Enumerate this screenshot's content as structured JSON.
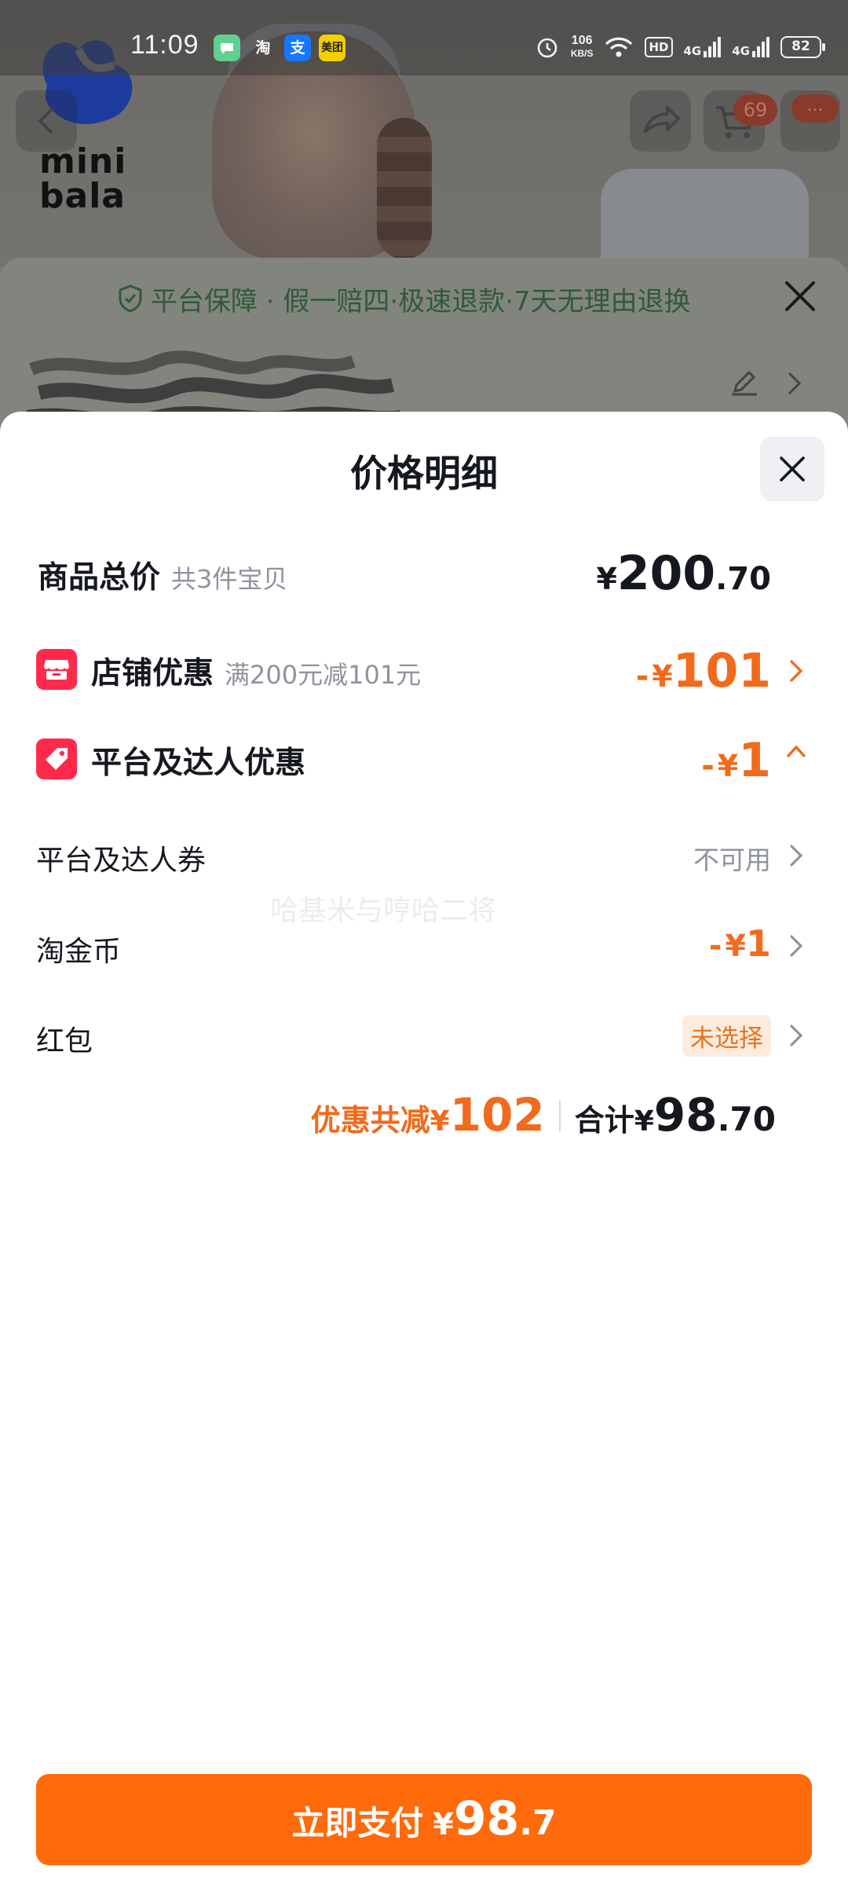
{
  "status_bar": {
    "time": "11:09",
    "apps": [
      {
        "name": "messages",
        "glyph": "",
        "color": "#5fd08f"
      },
      {
        "name": "taobao",
        "glyph": "淘",
        "color": "#5a5a5a"
      },
      {
        "name": "alipay",
        "glyph": "支",
        "color": "#1677ff"
      },
      {
        "name": "meituan",
        "glyph": "美团",
        "color": "#f5d000"
      }
    ],
    "net_speed_value": "106",
    "net_speed_unit": "KB/S",
    "hd_label": "HD",
    "signal1_label": "4G",
    "signal2_label": "4G",
    "battery": "82"
  },
  "background": {
    "brand_line1": "mini",
    "brand_line2": "bala",
    "cart_badge": "69",
    "more_badge": "...",
    "guarantee_text": "平台保障 · 假一赔四·极速退款·7天无理由退换"
  },
  "sheet": {
    "title": "价格明细",
    "total": {
      "label": "商品总价",
      "sub": "共3件宝贝",
      "currency": "¥",
      "int": "200",
      "dec": ".70"
    },
    "store_discount": {
      "label": "店铺优惠",
      "sub": "满200元减101元",
      "minus": "-",
      "currency": "¥",
      "value": "101"
    },
    "platform_discount": {
      "label": "平台及达人优惠",
      "minus": "-",
      "currency": "¥",
      "value": "1"
    },
    "platform_coupon": {
      "label": "平台及达人券",
      "value": "不可用"
    },
    "taojinbi": {
      "label": "淘金币",
      "minus": "-",
      "currency": "¥",
      "value": "1"
    },
    "red_packet": {
      "label": "红包",
      "value": "未选择"
    },
    "watermark": "哈基米与哼哈二将",
    "summary": {
      "discount_label": "优惠共减",
      "discount_currency": "¥",
      "discount_value": "102",
      "sum_label": "合计",
      "sum_currency": "¥",
      "sum_int": "98",
      "sum_dec": ".70"
    },
    "pay_button": {
      "label": "立即支付",
      "currency": "¥",
      "int": "98",
      "dec": ".7"
    }
  },
  "colors": {
    "accent_orange": "#f26a1b",
    "pay_button": "#ff6a0a",
    "store_icon_red": "#ff2a4b",
    "tag_bg": "#fdebde"
  }
}
